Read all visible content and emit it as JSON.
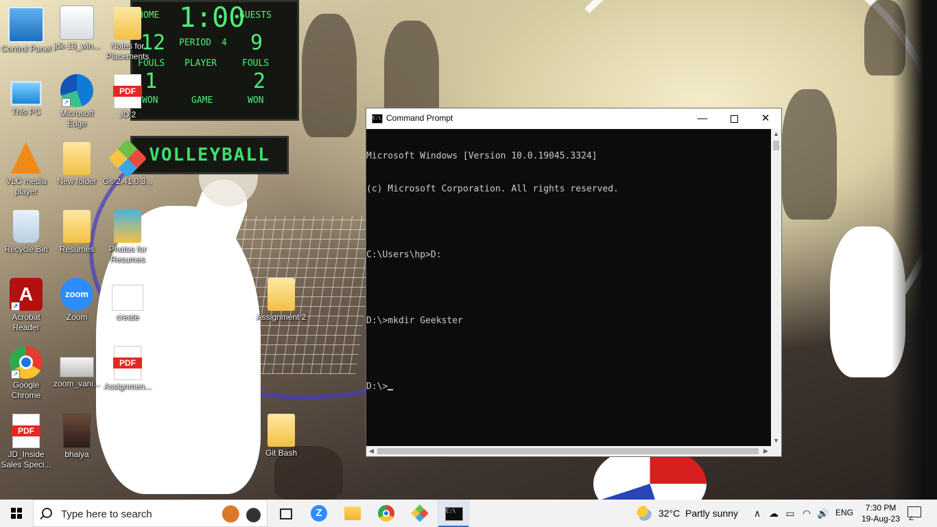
{
  "desktop": {
    "icons": [
      {
        "label": "Control Panel"
      },
      {
        "label": "jdk-19_win..."
      },
      {
        "label": "Notes for Placements"
      },
      {
        "label": "This PC"
      },
      {
        "label": "Microsoft Edge"
      },
      {
        "label": "JD 2"
      },
      {
        "label": "VLC media player"
      },
      {
        "label": "New folder"
      },
      {
        "label": "Git-2.41.0.3..."
      },
      {
        "label": "Recycle Bin"
      },
      {
        "label": "Resumes"
      },
      {
        "label": "Photos for Resumes"
      },
      {
        "label": "Acrobat Reader"
      },
      {
        "label": "Zoom"
      },
      {
        "label": "create"
      },
      {
        "label": "Assignment 2"
      },
      {
        "label": "Google Chrome"
      },
      {
        "label": "zoom_vani..."
      },
      {
        "label": "Assignmen..."
      },
      {
        "label": "JD_Inside Sales Speci..."
      },
      {
        "label": "bhaiya"
      },
      {
        "label": "Git Bash"
      }
    ],
    "wallpaper": {
      "scoreboard": {
        "home": "HOME",
        "time": "1:00",
        "guests": "GUESTS",
        "home_score": "12",
        "period_label": "PERIOD",
        "period": "4",
        "guests_score": "9",
        "fouls_left": "FOULS",
        "player_label": "PLAYER",
        "fouls_right": "FOULS",
        "home_fouls": "1",
        "guest_fouls": "2",
        "won_left": "WON",
        "game_label": "GAME",
        "won_right": "WON"
      },
      "sign": "VOLLEYBALL"
    },
    "pdf_badge": "PDF",
    "zoom_badge": "zoom"
  },
  "cmd": {
    "title": "Command Prompt",
    "icon_text": "C:\\",
    "min_glyph": "—",
    "close_glyph": "✕",
    "lines": [
      "Microsoft Windows [Version 10.0.19045.3324]",
      "(c) Microsoft Corporation. All rights reserved.",
      "",
      "C:\\Users\\hp>D:",
      "",
      "D:\\>mkdir Geekster",
      "",
      "D:\\>"
    ],
    "scroll_up": "▲",
    "scroll_down": "▼",
    "scroll_left": "◀",
    "scroll_right": "▶"
  },
  "taskbar": {
    "search_placeholder": "Type here to search",
    "zoom_glyph": "Z",
    "cmd_glyph": "C:\\",
    "weather_temp": "32°C",
    "weather_condition": "Partly sunny",
    "tray_chevron": "∧",
    "tray_cloud": "☁",
    "tray_battery": "▭",
    "tray_wifi": "◠",
    "tray_volume": "🔊",
    "language": "ENG",
    "time": "7:30 PM",
    "date": "19-Aug-23"
  }
}
